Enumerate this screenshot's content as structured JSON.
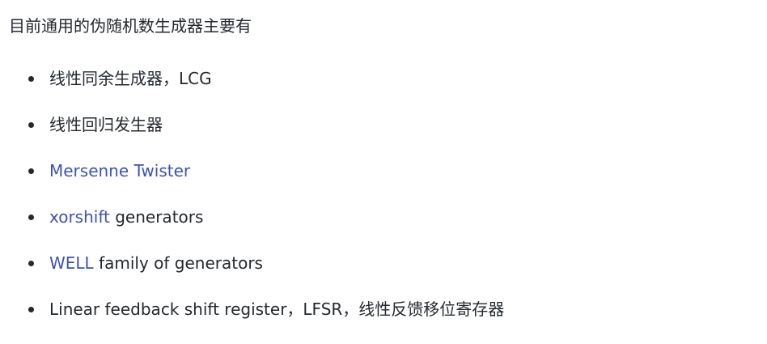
{
  "intro": "目前通用的伪随机数生成器主要有",
  "items": [
    {
      "link": "",
      "text": "线性同余生成器，LCG"
    },
    {
      "link": "",
      "text": "线性回归发生器"
    },
    {
      "link": "Mersenne Twister",
      "text": ""
    },
    {
      "link": "xorshift",
      "text": " generators"
    },
    {
      "link": "WELL",
      "text": " family of generators"
    },
    {
      "link": "",
      "text": "Linear feedback shift register，LFSR，线性反馈移位寄存器"
    }
  ],
  "colors": {
    "text": "#24292f",
    "link": "#3b53b8"
  }
}
